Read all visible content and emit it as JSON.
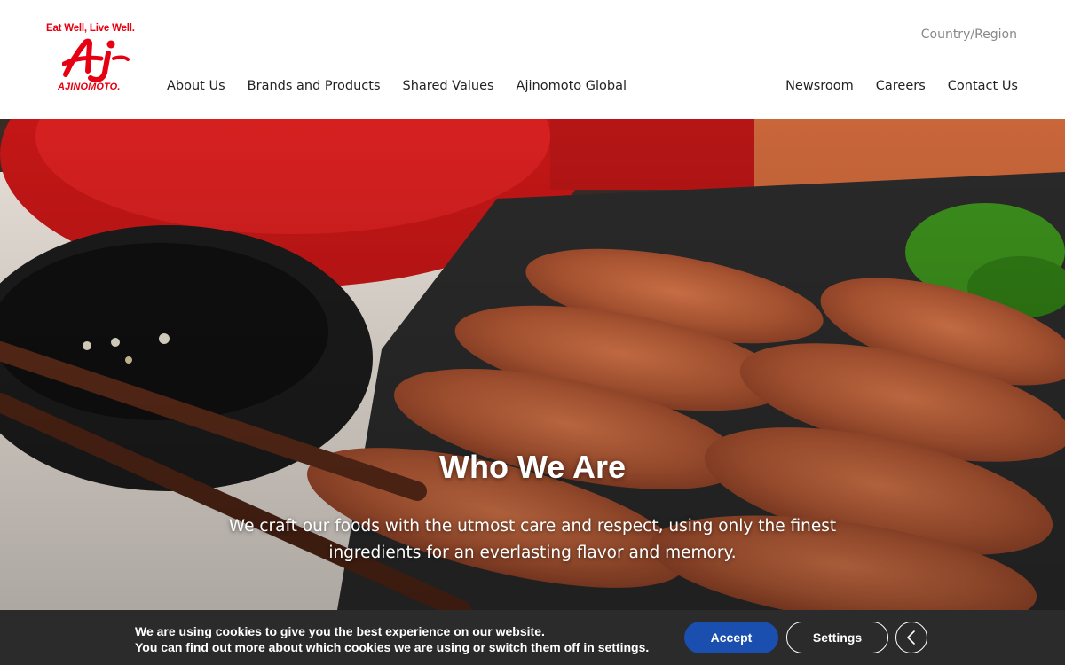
{
  "brand": {
    "tagline": "Eat Well, Live Well.",
    "mark": "Aj",
    "wordmark": "AJINOMOTO.",
    "color": "#e60012"
  },
  "header": {
    "country_region": "Country/Region",
    "nav_left": [
      "About Us",
      "Brands and Products",
      "Shared Values",
      "Ajinomoto Global"
    ],
    "nav_right": [
      "Newsroom",
      "Careers",
      "Contact Us"
    ]
  },
  "hero": {
    "title": "Who We Are",
    "text": "We craft our foods with the utmost care and respect, using only the finest ingredients for an everlasting flavor and memory."
  },
  "cookie": {
    "line1": "We are using cookies to give you the best experience on our website.",
    "line2_prefix": "You can find out more about which cookies we are using or switch them off in ",
    "line2_link": "settings",
    "line2_suffix": ".",
    "accept_label": "Accept",
    "settings_label": "Settings",
    "close_icon": "chevron-left-icon",
    "accept_color": "#1a4fb0"
  }
}
